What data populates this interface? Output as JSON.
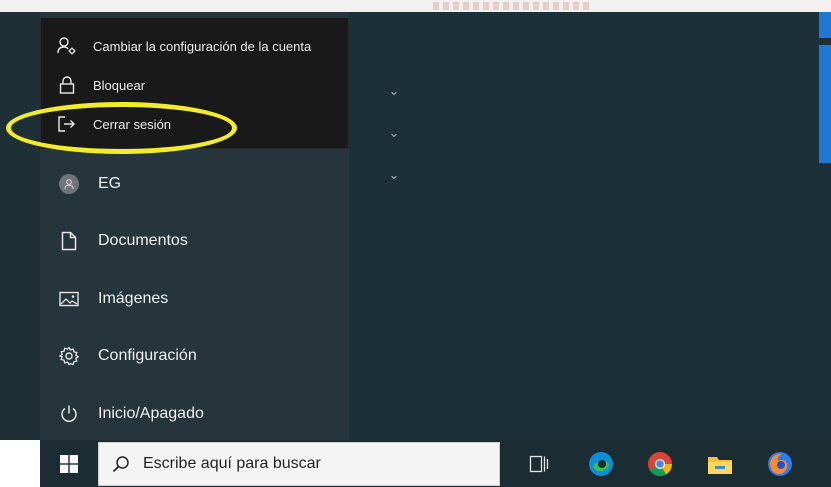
{
  "user_flyout": {
    "items": [
      {
        "label": "Cambiar la configuración de la cuenta",
        "icon": "account-settings-icon"
      },
      {
        "label": "Bloquear",
        "icon": "lock-icon"
      },
      {
        "label": "Cerrar sesión",
        "icon": "sign-out-icon"
      }
    ]
  },
  "start_menu": {
    "user": {
      "initials": "EG",
      "icon": "avatar-icon"
    },
    "items": [
      {
        "label": "Documentos",
        "icon": "document-icon"
      },
      {
        "label": "Imágenes",
        "icon": "pictures-icon"
      },
      {
        "label": "Configuración",
        "icon": "gear-icon"
      },
      {
        "label": "Inicio/Apagado",
        "icon": "power-icon"
      }
    ]
  },
  "tiles": {
    "expanders": [
      "chevron-down-icon",
      "chevron-down-icon",
      "chevron-down-icon"
    ]
  },
  "taskbar": {
    "search_placeholder": "Escribe aquí para buscar",
    "icons": [
      "windows-start-icon",
      "search-icon",
      "task-view-icon",
      "edge-icon",
      "chrome-icon",
      "file-explorer-icon",
      "firefox-icon"
    ]
  },
  "colors": {
    "highlight": "#f2ec2a",
    "accent": "#1e78d4",
    "flyout_bg": "#191919",
    "menu_bg": "#26343b"
  }
}
